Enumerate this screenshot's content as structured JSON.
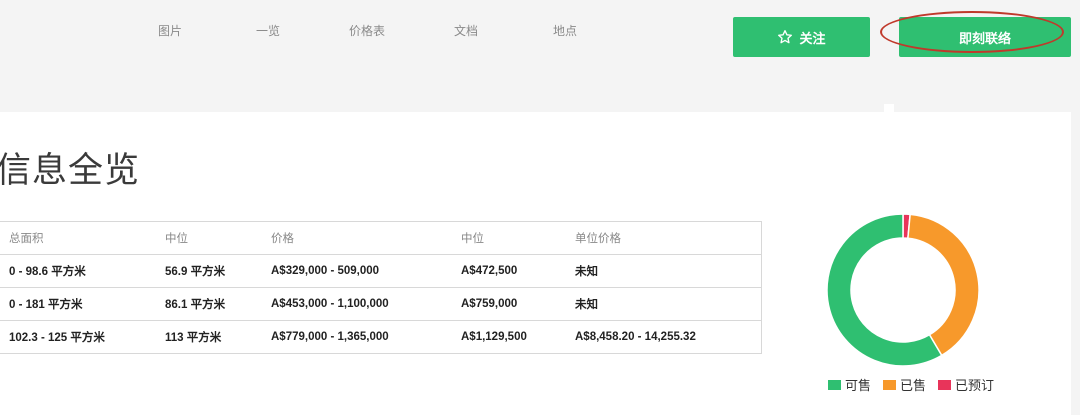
{
  "nav": {
    "links": [
      "图片",
      "一览",
      "价格表",
      "文档",
      "地点"
    ],
    "follow_label": "关注",
    "contact_label": "即刻联络"
  },
  "main": {
    "title": "信息全览",
    "table": {
      "headers": [
        "总面积",
        "中位",
        "价格",
        "中位",
        "单位价格"
      ],
      "rows": [
        [
          "0 - 98.6 平方米",
          "56.9 平方米",
          "A$329,000 - 509,000",
          "A$472,500",
          "未知"
        ],
        [
          "0 - 181 平方米",
          "86.1 平方米",
          "A$453,000 - 1,100,000",
          "A$759,000",
          "未知"
        ],
        [
          "102.3 - 125 平方米",
          "113 平方米",
          "A$779,000 - 1,365,000",
          "A$1,129,500",
          "A$8,458.20 - 14,255.32"
        ]
      ]
    }
  },
  "chart_data": {
    "type": "pie",
    "donut": true,
    "categories": [
      "可售",
      "已售",
      "已预订"
    ],
    "values": [
      58.5,
      40,
      1.5
    ],
    "colors": [
      "#2fbf71",
      "#f7992b",
      "#e8345a"
    ],
    "legend_position": "bottom"
  },
  "colors": {
    "accent": "#2fbf71",
    "highlight_circle": "#c0392b"
  }
}
